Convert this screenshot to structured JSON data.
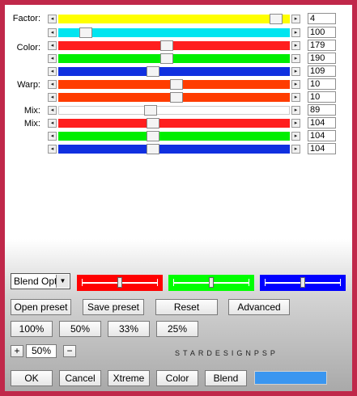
{
  "labels": {
    "factor": "Factor:",
    "color": "Color:",
    "warp": "Warp:",
    "mix1": "Mix:",
    "mix2": "Mix:"
  },
  "arrows": {
    "left": "◂",
    "right": "▸"
  },
  "sliders": [
    {
      "value": "4",
      "color": "#ffff00",
      "level": 0.94
    },
    {
      "value": "100",
      "color": "#00e5f0",
      "level": 0.12
    },
    {
      "value": "179",
      "color": "#ff1e1e",
      "level": 0.47
    },
    {
      "value": "190",
      "color": "#00ee00",
      "level": 0.47
    },
    {
      "value": "109",
      "color": "#1030e0",
      "level": 0.41
    },
    {
      "value": "10",
      "color": "#ff3c00",
      "level": 0.51
    },
    {
      "value": "10",
      "color": "#ff3c00",
      "level": 0.51
    },
    {
      "value": "89",
      "color": "#ffffff",
      "level": 0.4
    },
    {
      "value": "104",
      "color": "#ff1e1e",
      "level": 0.41
    },
    {
      "value": "104",
      "color": "#00ee00",
      "level": 0.41
    },
    {
      "value": "104",
      "color": "#1030e0",
      "level": 0.41
    }
  ],
  "blend_dropdown": {
    "value": "Blend Optio",
    "icon": "chevron-down-icon"
  },
  "mini_sliders": [
    {
      "color": "#ff0000",
      "level": 0.5
    },
    {
      "color": "#00ff00",
      "level": 0.5
    },
    {
      "color": "#0000ff",
      "level": 0.5
    }
  ],
  "buttons": {
    "open_preset": "Open preset",
    "save_preset": "Save preset",
    "reset": "Reset",
    "advanced": "Advanced",
    "z100": "100%",
    "z50": "50%",
    "z33": "33%",
    "z25": "25%",
    "plus": "+",
    "minus": "−",
    "zoom_value": "50%",
    "ok": "OK",
    "cancel": "Cancel",
    "xtreme": "Xtreme",
    "color": "Color",
    "blend": "Blend"
  },
  "watermark": "STARDESIGNPSP",
  "swatch_color": "#3a96f0"
}
